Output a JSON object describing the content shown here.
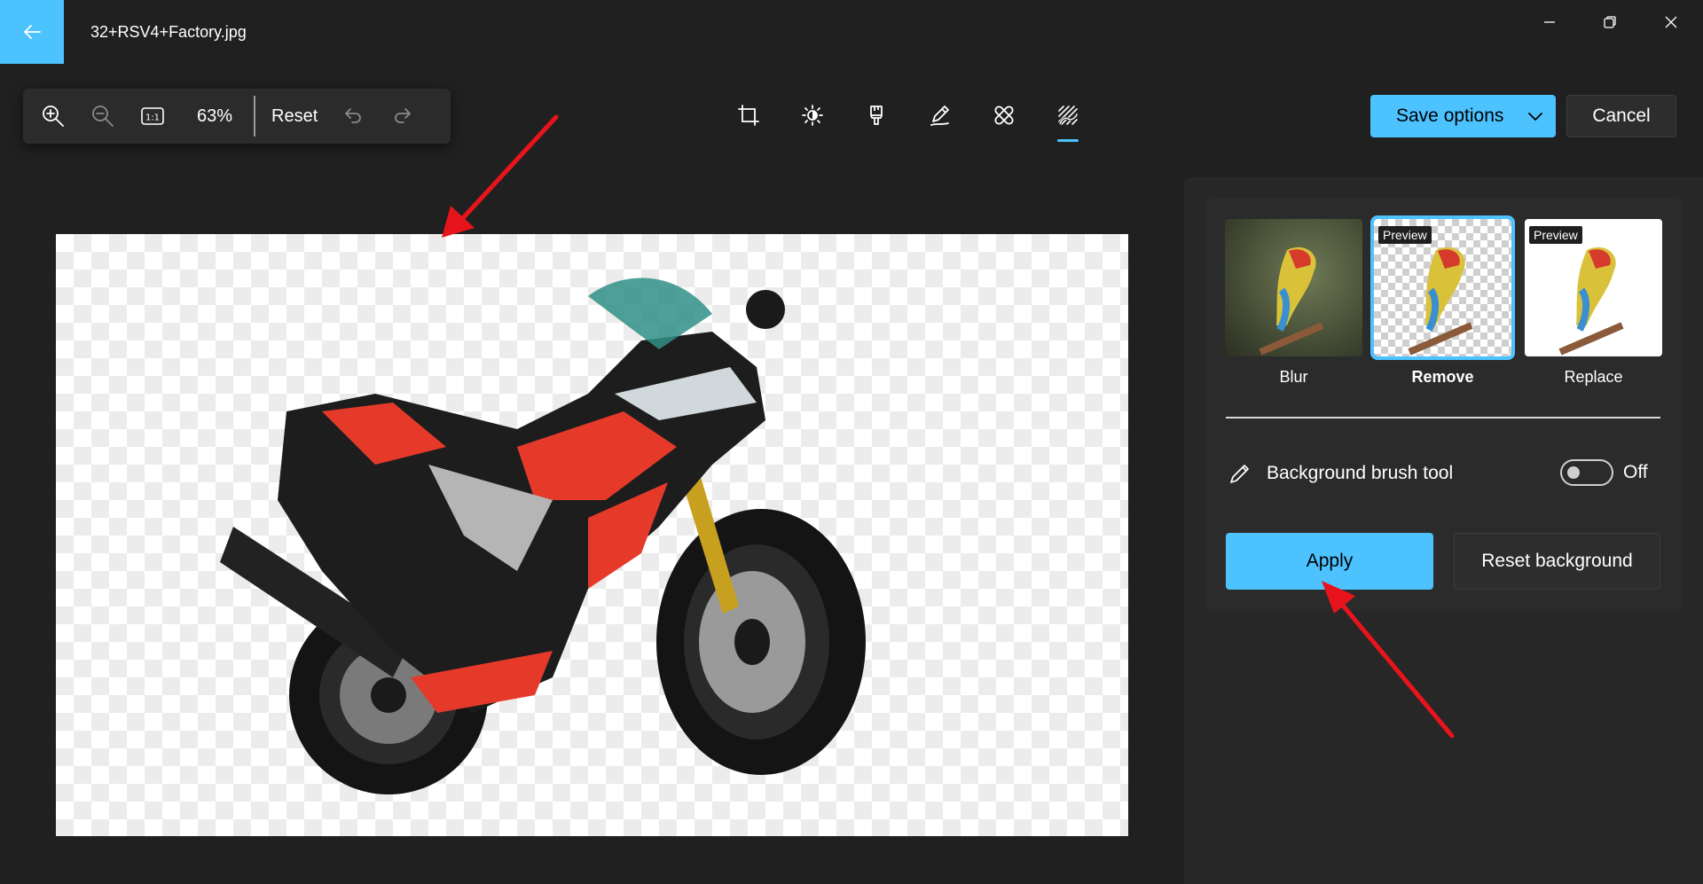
{
  "titlebar": {
    "file_name": "32+RSV4+Factory.jpg",
    "back_icon": "arrow-left",
    "controls": [
      "minimize-icon",
      "restore-icon",
      "close-icon"
    ]
  },
  "zoom_toolbar": {
    "zoom_in_icon": "zoom-in",
    "zoom_out_icon": "zoom-out",
    "actual_size_label": "1:1",
    "zoom_level": "63%",
    "reset_label": "Reset",
    "undo_icon": "undo",
    "redo_icon": "redo"
  },
  "edit_tools": {
    "items": [
      "crop-icon",
      "adjust-icon",
      "filter-icon",
      "markup-icon",
      "retouch-icon",
      "background-icon"
    ],
    "active": "background-icon"
  },
  "actions": {
    "save_label": "Save options",
    "cancel_label": "Cancel"
  },
  "background_panel": {
    "options": [
      {
        "label": "Blur",
        "selected": false,
        "preview_tag": ""
      },
      {
        "label": "Remove",
        "selected": true,
        "preview_tag": "Preview"
      },
      {
        "label": "Replace",
        "selected": false,
        "preview_tag": "Preview"
      }
    ],
    "brush_tool_label": "Background brush tool",
    "brush_tool_state": "Off",
    "apply_label": "Apply",
    "reset_background_label": "Reset background"
  },
  "colors": {
    "accent": "#4cc2ff",
    "background": "#202020",
    "panel": "#2b2b2b",
    "annotation_arrow": "#e8141c"
  }
}
